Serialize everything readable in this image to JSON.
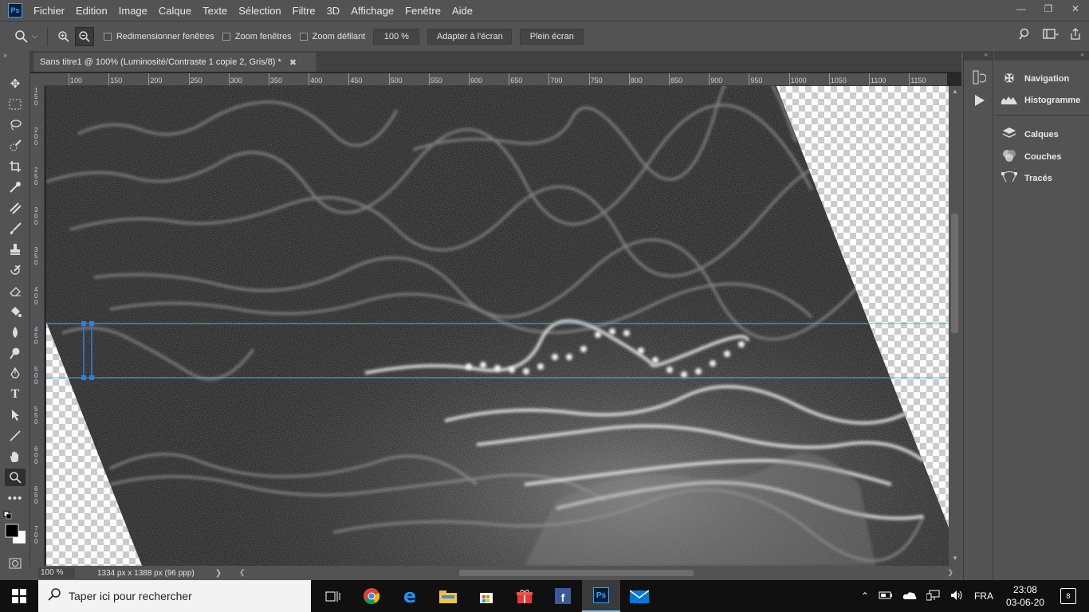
{
  "menubar": {
    "logo": "Ps",
    "items": [
      "Fichier",
      "Edition",
      "Image",
      "Calque",
      "Texte",
      "Sélection",
      "Filtre",
      "3D",
      "Affichage",
      "Fenêtre",
      "Aide"
    ]
  },
  "options": {
    "resize_windows": "Redimensionner fenêtres",
    "zoom_windows": "Zoom fenêtres",
    "scrubby_zoom": "Zoom défilant",
    "zoom_value": "100 %",
    "fit_screen": "Adapter à l'écran",
    "full_screen": "Plein écran"
  },
  "document": {
    "tab_title": "Sans titre1 @ 100% (Luminosité/Contraste 1 copie 2, Gris/8) *",
    "ruler_top": [
      "100",
      "150",
      "200",
      "250",
      "300",
      "350",
      "400",
      "450",
      "500",
      "550",
      "600",
      "650",
      "700",
      "750",
      "800",
      "850",
      "900",
      "950",
      "1000",
      "1050",
      "1100",
      "1150"
    ],
    "ruler_left": [
      "150",
      "200",
      "250",
      "300",
      "350",
      "400",
      "450",
      "500",
      "550",
      "600",
      "650",
      "700"
    ],
    "status_zoom": "100 %",
    "status_info": "1334 px x 1388 px (96 ppp)"
  },
  "panels": {
    "navigation": "Navigation",
    "histogram": "Histogramme",
    "layers": "Calques",
    "channels": "Couches",
    "paths": "Tracés"
  },
  "taskbar": {
    "search_placeholder": "Taper ici pour rechercher",
    "language": "FRA",
    "time": "23:08",
    "date": "03-06-20",
    "notifications": "8"
  },
  "colors": {
    "ui_bg": "#535353",
    "guide": "#29c5e6",
    "accent": "#31a8ff"
  }
}
